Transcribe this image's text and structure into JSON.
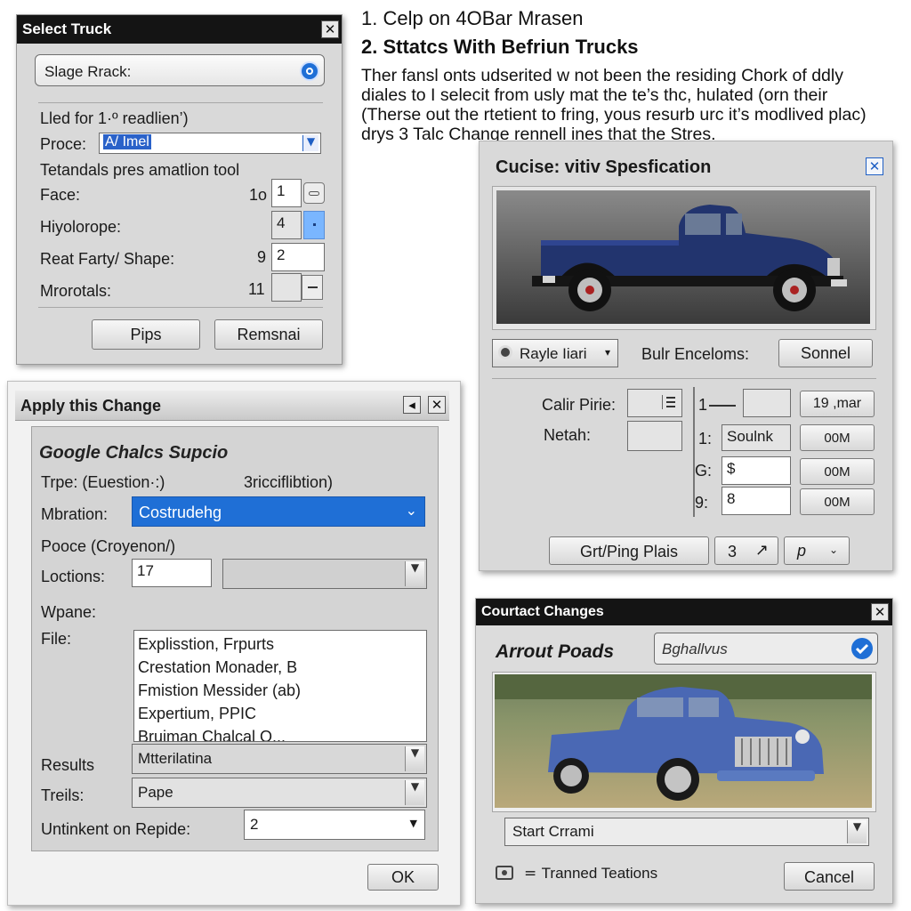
{
  "instructions": {
    "line1": "1. Celp on 4OBar Mrasen",
    "line2": "2. Sttatcs With Befriun Trucks",
    "para": [
      "Ther fansl onts udserited w not been the residing Chork of ddly",
      "diales to I selecit from usly mat the te’s thc, hulated (orn their",
      "(Therse out the rtetient to fring, yous resurb urc it’s modlived plac)",
      "drys 3 Talc Change rennell ines that the Stres."
    ]
  },
  "select_truck": {
    "title": "Select Truck",
    "close": "✕",
    "search_placeholder": "Slage Rrack:",
    "line1": "Lled for 1·º readlien’)",
    "proce_label": "Proce:",
    "proce_value": "A/ Imel",
    "line2": "Tetandals pres amatlion tool",
    "face_label": "Face:",
    "face_num": "1o",
    "face_value": "1",
    "hyd_label": "Hiyolorope:",
    "hyd_value": "4",
    "reat_label": "Reat Farty/ Shape:",
    "reat_num": "9",
    "reat_value": "2",
    "mro_label": "Mrorotals:",
    "mro_num": "11",
    "btn_pips": "Pips",
    "btn_remsnai": "Remsnai"
  },
  "apply_change": {
    "title": "Apply this Change",
    "heading": "Google Chalcs Supcio",
    "type_label": "Trpe: (Euestion·:)",
    "type_right": "3ricciflibtion)",
    "mbr_label": "Mbration:",
    "mbr_value": "Costrudehg",
    "pooce_label": "Pooce (Croyenon/)",
    "loc_label": "Loctions:",
    "loc_value": "17",
    "wpane_label": "Wpane:",
    "file_label": "File:",
    "file_items": [
      "Explisstion, Frpurts",
      "Crestation Monader, B",
      "Fmistion Messider (ab)",
      "Expertium, PPIC",
      "Bruiman Chalcal O..."
    ],
    "results_label": "Results",
    "results_value": "Mtterilatina",
    "treils_label": "Treils:",
    "treils_value": "Pape",
    "until_label": "Untinkent on Repide:",
    "until_value": "2",
    "ok": "OK"
  },
  "spec": {
    "title": "Cucise: vitiv Spesfication",
    "close": "✕",
    "rayle_label": "Rayle Iiari",
    "bulr_label": "Bulr Enceloms:",
    "sonnel": "Sonnel",
    "calir_label": "Calir Pirie:",
    "netah_label": "Netah:",
    "row1_num": "1",
    "row2_num": "1:",
    "row2_value": "Soulnk",
    "row3_num": "G:",
    "row3_value": "$",
    "row4_num": "9:",
    "row4_value": "8",
    "btn_19mar": "19 ,mar",
    "btn_00m_1": "00M",
    "btn_00m_2": "00M",
    "btn_00m_3": "00M",
    "grt_btn": "Grt/Ping Plais",
    "three_btn": "3",
    "p_btn": "p"
  },
  "courtact": {
    "title": "Courtact Changes",
    "heading": "Arrout Poads",
    "search_value": "Bghallvus",
    "start": "Start Crrami",
    "trained": "Tranned Teations",
    "cancel": "Cancel"
  },
  "colors": {
    "accent_blue": "#1f6fd6",
    "truck_blue": "#22346e",
    "truck_blue2": "#4a68b4"
  }
}
